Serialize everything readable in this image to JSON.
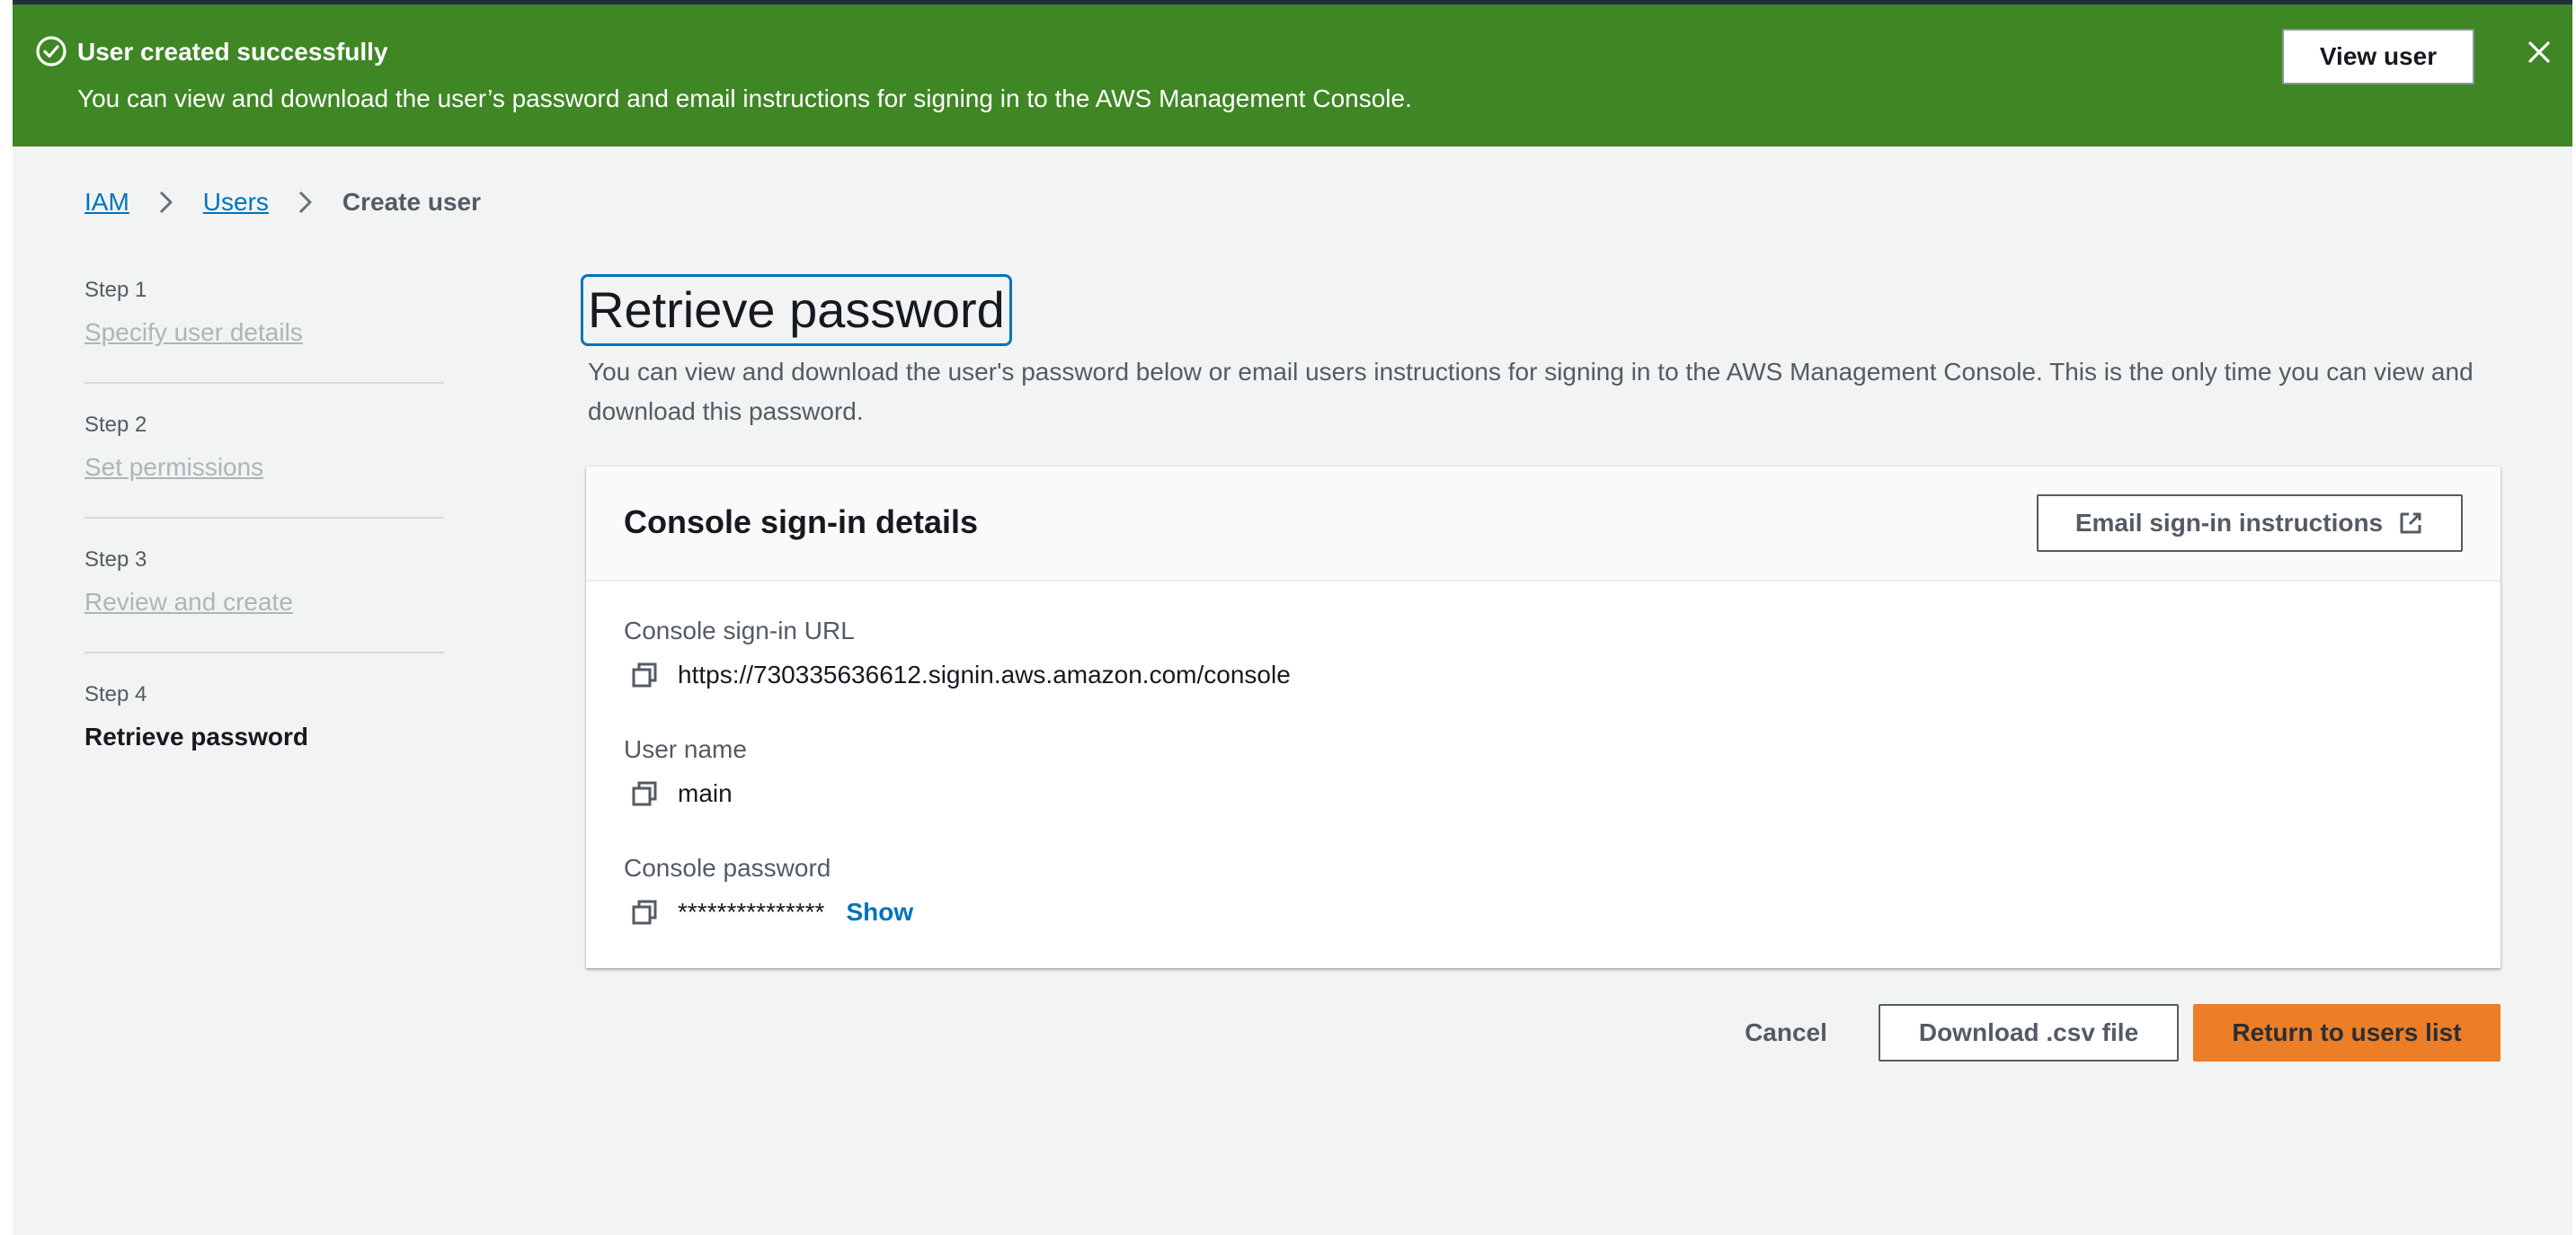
{
  "flash": {
    "icon": "check-circle-icon",
    "title": "User created successfully",
    "message": "You can view and download the user’s password and email instructions for signing in to the AWS Management Console.",
    "button_label": "View user",
    "close_icon": "close-icon",
    "color": "#3f8624"
  },
  "breadcrumb": {
    "items": [
      "IAM",
      "Users"
    ],
    "current": "Create user"
  },
  "steps": [
    {
      "label": "Step 1",
      "title": "Specify user details",
      "state": "disabled"
    },
    {
      "label": "Step 2",
      "title": "Set permissions",
      "state": "disabled"
    },
    {
      "label": "Step 3",
      "title": "Review and create",
      "state": "disabled"
    },
    {
      "label": "Step 4",
      "title": "Retrieve password",
      "state": "current"
    }
  ],
  "page": {
    "title": "Retrieve password",
    "description": "You can view and download the user's password below or email users instructions for signing in to the AWS Management Console. This is the only time you can view and download this password."
  },
  "details": {
    "title": "Console sign-in details",
    "email_button": "Email sign-in instructions",
    "email_icon": "external-link-icon",
    "fields": [
      {
        "label": "Console sign-in URL",
        "value": "https://730335636612.signin.aws.amazon.com/console"
      },
      {
        "label": "User name",
        "value": "main"
      },
      {
        "label": "Console password",
        "value": "***************",
        "action": "Show"
      }
    ]
  },
  "actions": {
    "cancel": "Cancel",
    "download": "Download .csv file",
    "primary": "Return to users list",
    "primary_color": "#ec7211",
    "link_color": "#0073bb"
  }
}
